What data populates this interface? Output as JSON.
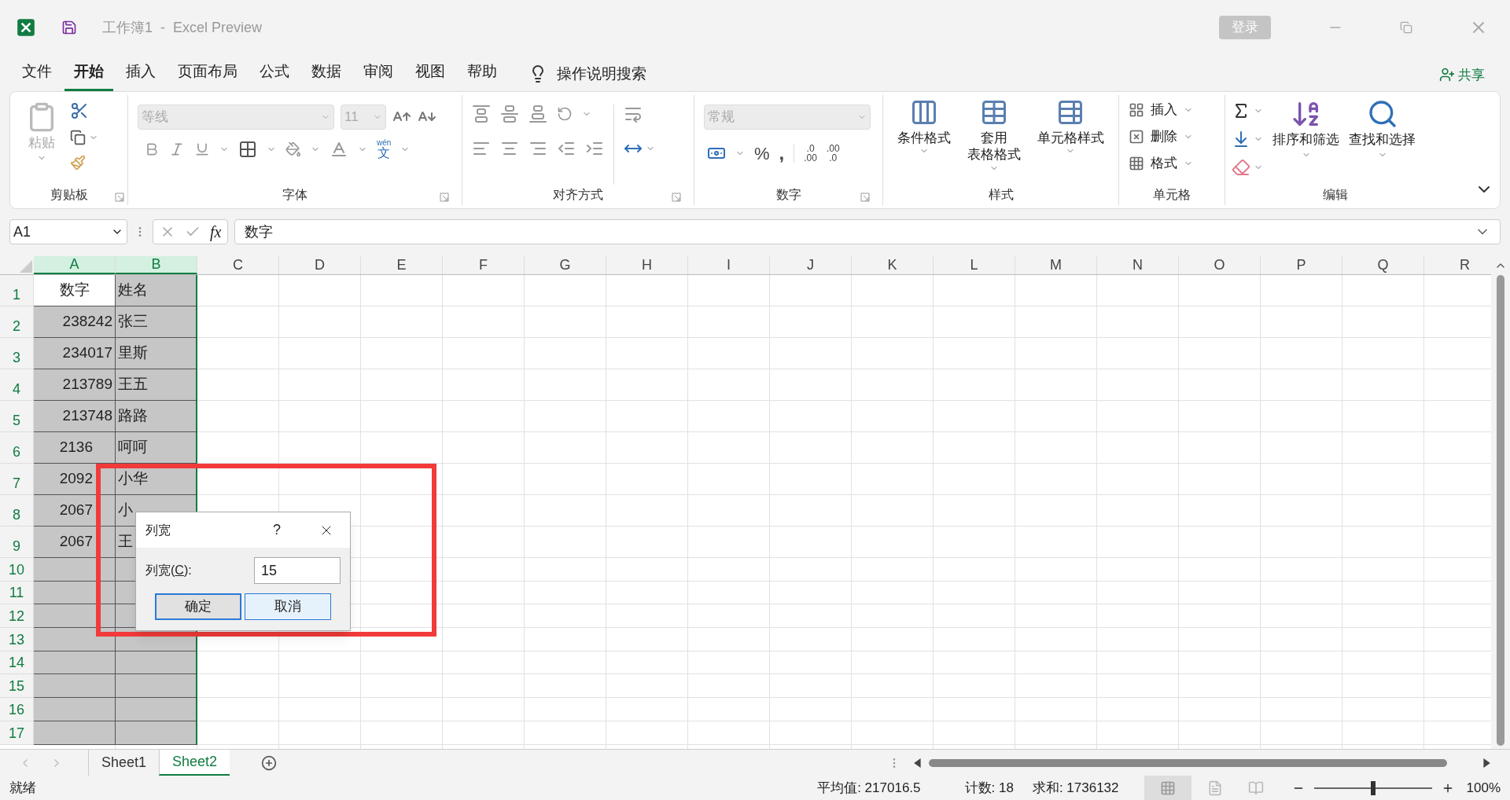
{
  "title_bar": {
    "title": "工作簿1  -  Excel Preview",
    "sign_in": "登录"
  },
  "menu_tabs": [
    {
      "label": "文件",
      "selected": false
    },
    {
      "label": "开始",
      "selected": true
    },
    {
      "label": "插入",
      "selected": false
    },
    {
      "label": "页面布局",
      "selected": false
    },
    {
      "label": "公式",
      "selected": false
    },
    {
      "label": "数据",
      "selected": false
    },
    {
      "label": "审阅",
      "selected": false
    },
    {
      "label": "视图",
      "selected": false
    },
    {
      "label": "帮助",
      "selected": false
    }
  ],
  "tell_me": "操作说明搜索",
  "share": "共享",
  "ribbon": {
    "clipboard": {
      "paste": "粘贴",
      "label": "剪贴板"
    },
    "font": {
      "font_name": "等线",
      "font_size": "11",
      "phonetic_top": "wén",
      "phonetic_bottom": "文",
      "label": "字体"
    },
    "alignment": {
      "label": "对齐方式"
    },
    "number": {
      "format": "常规",
      "percent": "%",
      "comma": ",",
      "increase_decimal": [
        ".0",
        ".00"
      ],
      "decrease_decimal": [
        ".00",
        ".0"
      ],
      "label": "数字"
    },
    "styles": {
      "buttons": [
        {
          "kind": "conditional",
          "lines": [
            "条件格式"
          ]
        },
        {
          "kind": "table",
          "lines": [
            "套用",
            "表格格式"
          ]
        },
        {
          "kind": "cell",
          "lines": [
            "单元格样式"
          ]
        }
      ],
      "label": "样式"
    },
    "cells": {
      "buttons": [
        {
          "kind": "insert",
          "label": "插入"
        },
        {
          "kind": "delete",
          "label": "删除"
        },
        {
          "kind": "format",
          "label": "格式"
        }
      ],
      "label": "单元格"
    },
    "editing": {
      "sort_filter": "排序和筛选",
      "find_select": "查找和选择",
      "label": "编辑"
    }
  },
  "formula_bar": {
    "name_box": "A1",
    "fx": "fx",
    "formula": "数字"
  },
  "columns": [
    {
      "label": "A",
      "selected": true
    },
    {
      "label": "B",
      "selected": true
    },
    {
      "label": "C",
      "selected": false
    },
    {
      "label": "D",
      "selected": false
    },
    {
      "label": "E",
      "selected": false
    },
    {
      "label": "F",
      "selected": false
    },
    {
      "label": "G",
      "selected": false
    },
    {
      "label": "H",
      "selected": false
    },
    {
      "label": "I",
      "selected": false
    },
    {
      "label": "J",
      "selected": false
    },
    {
      "label": "K",
      "selected": false
    },
    {
      "label": "L",
      "selected": false
    },
    {
      "label": "M",
      "selected": false
    },
    {
      "label": "N",
      "selected": false
    },
    {
      "label": "O",
      "selected": false
    },
    {
      "label": "P",
      "selected": false
    },
    {
      "label": "Q",
      "selected": false
    },
    {
      "label": "R",
      "selected": false
    }
  ],
  "rows": [
    {
      "number": "1",
      "a": "数字",
      "b": "姓名",
      "kind": "header"
    },
    {
      "number": "2",
      "a": "238242",
      "b": "张三",
      "kind": "full"
    },
    {
      "number": "3",
      "a": "234017",
      "b": "里斯",
      "kind": "full"
    },
    {
      "number": "4",
      "a": "213789",
      "b": "王五",
      "kind": "full"
    },
    {
      "number": "5",
      "a": "213748",
      "b": "路路",
      "kind": "full"
    },
    {
      "number": "6",
      "a": "2136",
      "b": "呵呵",
      "kind": "partial"
    },
    {
      "number": "7",
      "a": "2092",
      "b": "小华",
      "kind": "partial"
    },
    {
      "number": "8",
      "a": "2067",
      "b": "小",
      "kind": "partial"
    },
    {
      "number": "9",
      "a": "2067",
      "b": "王",
      "kind": "partial"
    },
    {
      "number": "10"
    },
    {
      "number": "11"
    },
    {
      "number": "12"
    },
    {
      "number": "13"
    },
    {
      "number": "14"
    },
    {
      "number": "15"
    },
    {
      "number": "16"
    },
    {
      "number": "17"
    }
  ],
  "dialog": {
    "title": "列宽",
    "help": "?",
    "label_before": "列宽(",
    "access_key": "C",
    "label_after": "):",
    "value": "15",
    "ok": "确定",
    "cancel": "取消"
  },
  "sheet_tabs": [
    {
      "label": "Sheet1",
      "selected": false
    },
    {
      "label": "Sheet2",
      "selected": true
    }
  ],
  "status_bar": {
    "status": "就绪",
    "average": "平均值: 217016.5",
    "count": "计数: 18",
    "sum": "求和: 1736132",
    "zoom_slider": {
      "level": 0.5
    },
    "zoom": "100%"
  }
}
